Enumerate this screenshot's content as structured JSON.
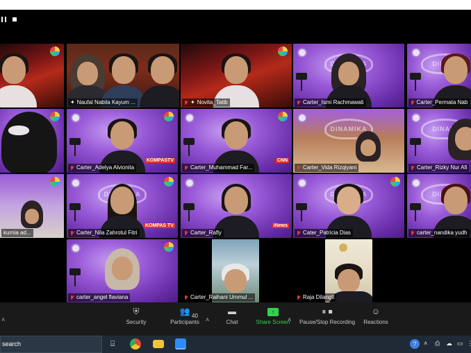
{
  "meeting_controls": {
    "pause_icon": "pause-icon",
    "stop_icon": "stop-icon"
  },
  "participants": [
    {
      "name": "kurnia ad...",
      "show_name": false
    },
    {
      "name": "Naufal Nabila Kayum ...",
      "pinned": true,
      "muted": false
    },
    {
      "name": "Novita_Tatib",
      "pinned": true,
      "muted": true
    },
    {
      "name": "Carter_Ismi Rachmawati",
      "muted": true
    },
    {
      "name": "Carter_Permata Nab",
      "muted": true
    },
    {
      "name": "",
      "show_name": false
    },
    {
      "name": "Carter_Adelya Alvionita",
      "muted": true
    },
    {
      "name": "Carter_Muhammad Far...",
      "muted": true
    },
    {
      "name": "Carter_Vida Rizqiyani",
      "muted": true
    },
    {
      "name": "Carter_Rizky Nur Afi",
      "muted": true
    },
    {
      "name": "kurnia ad...",
      "muted": false
    },
    {
      "name": "Carter_Nila Zahrotul Fitri",
      "muted": true
    },
    {
      "name": "Carter_Rafly",
      "muted": true
    },
    {
      "name": "Cater_Patricia Dias",
      "muted": true
    },
    {
      "name": "carter_nandika yudh",
      "muted": true
    },
    {
      "name": "carter_angel flaviana",
      "muted": true
    },
    {
      "name": "Carter_Raihani Ummul ...",
      "muted": true
    },
    {
      "name": "Raja Dilangit",
      "muted": true
    }
  ],
  "tile_text": {
    "dinamika": "DINAMIKA",
    "dinami": "DINAMI",
    "ticker_kompas": "KOMPASTV",
    "ticker_cnn": "CNN",
    "ticker_inews": "iNews",
    "ticker_kompas2": "KOMPAS TV"
  },
  "toolbar": {
    "security": "Security",
    "participants": "Participants",
    "participants_count": "40",
    "chat": "Chat",
    "share_screen": "Share Screen",
    "pause_recording": "Pause/Stop Recording",
    "reactions": "Reactions"
  },
  "taskbar": {
    "search": "search",
    "apps": [
      "task-view-icon",
      "chrome-icon",
      "file-explorer-icon",
      "zoom-icon"
    ]
  },
  "colors": {
    "active_speaker": "#b8e23a",
    "share_green": "#2fd24a",
    "muted_red": "#e23b3b"
  }
}
